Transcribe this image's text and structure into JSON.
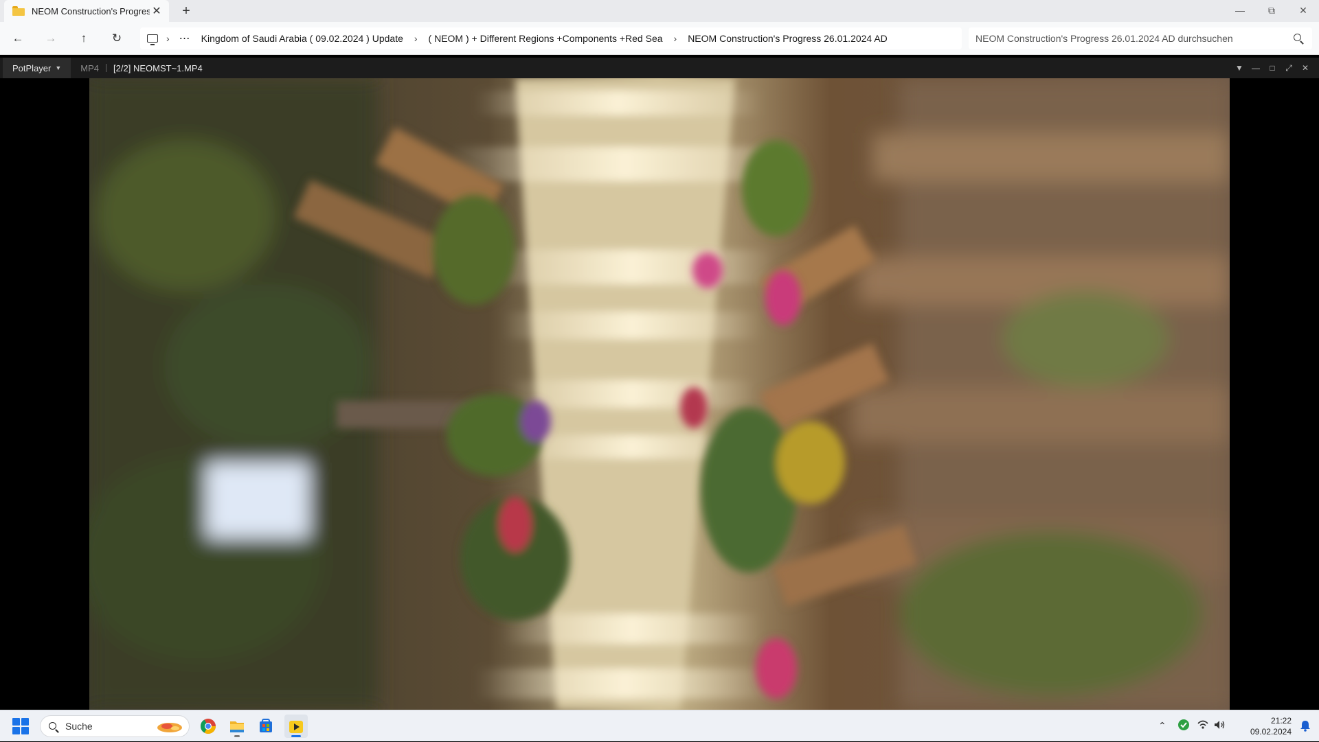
{
  "explorer": {
    "tab_title": "NEOM Construction's Progress",
    "tab_close_glyph": "✕",
    "new_tab_glyph": "+",
    "breadcrumbs": [
      "Kingdom of Saudi Arabia ( 09.02.2024 ) Update",
      "( NEOM ) + Different Regions +Components +Red Sea",
      "NEOM Construction's Progress 26.01.2024 AD"
    ],
    "search_placeholder": "NEOM Construction's Progress 26.01.2024 AD durchsuchen",
    "icons": [
      "folder-icon",
      "back-arrow-icon",
      "forward-arrow-icon",
      "up-arrow-icon",
      "refresh-icon",
      "this-pc-icon",
      "chevron-right-icon",
      "more-icon",
      "search-icon"
    ],
    "window_controls": [
      "minimize",
      "restore",
      "close"
    ]
  },
  "player": {
    "app_menu": "PotPlayer",
    "format": "MP4",
    "file": "[2/2] NEOMST~1.MP4",
    "controls": [
      "pin-icon",
      "minimize-icon",
      "maximize-icon",
      "fullscreen-icon",
      "close-icon"
    ]
  },
  "taskbar": {
    "search_label": "Suche",
    "apps": [
      "chrome-icon",
      "file-explorer-icon",
      "microsoft-store-icon",
      "potplayer-icon"
    ],
    "time": "21:22",
    "date": "09.02.2024",
    "tray_icons": [
      "chevron-up-icon",
      "security-icon",
      "wifi-icon",
      "volume-icon",
      "notification-bell-icon"
    ]
  },
  "colors": {
    "accent": "#1a73e8",
    "player_bar": "#1c1c1c",
    "security_green": "#2ea043"
  }
}
